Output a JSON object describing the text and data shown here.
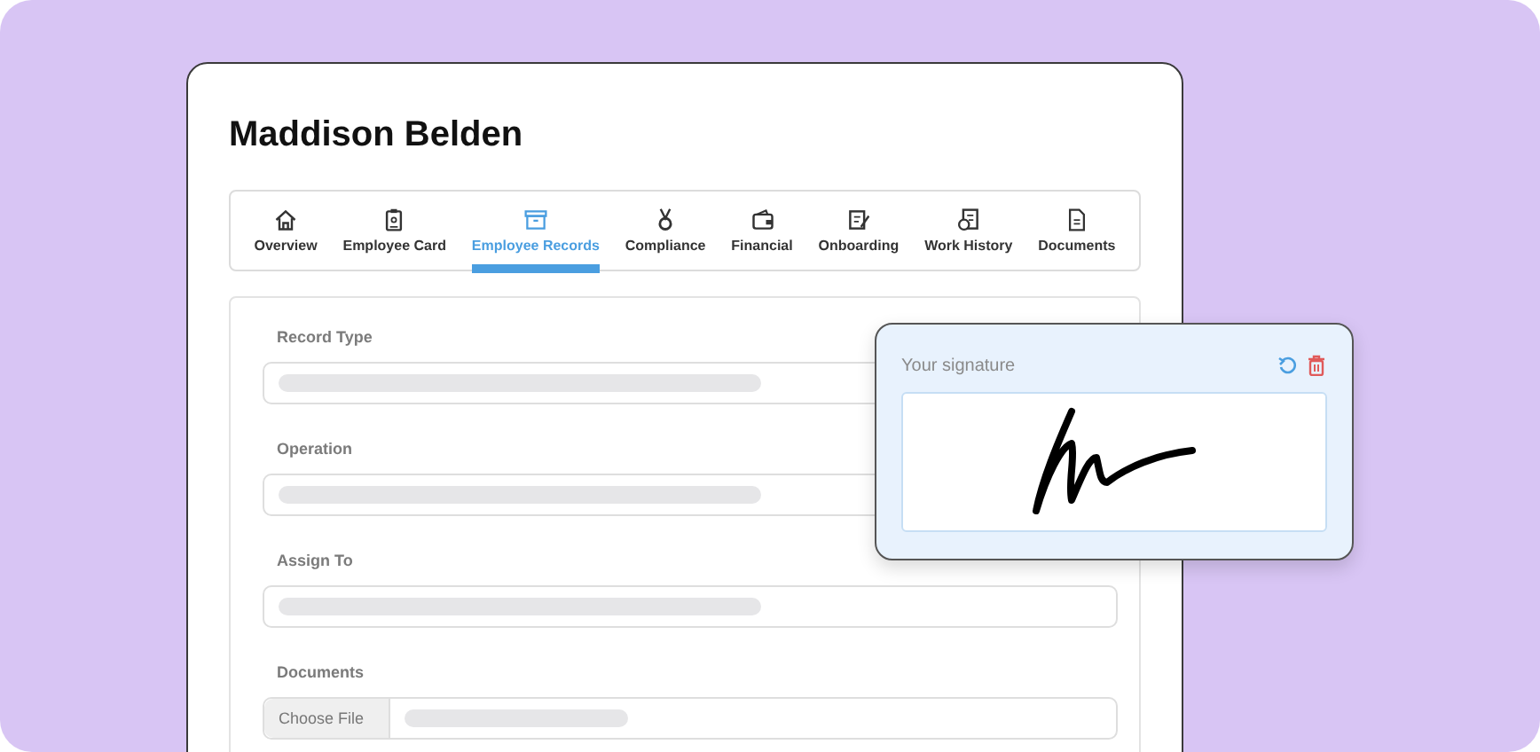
{
  "title": "Maddison Belden",
  "tabs": [
    {
      "label": "Overview",
      "selected": false
    },
    {
      "label": "Employee Card",
      "selected": false
    },
    {
      "label": "Employee Records",
      "selected": true
    },
    {
      "label": "Compliance",
      "selected": false
    },
    {
      "label": "Financial",
      "selected": false
    },
    {
      "label": "Onboarding",
      "selected": false
    },
    {
      "label": "Work History",
      "selected": false
    },
    {
      "label": "Documents",
      "selected": false
    }
  ],
  "fields": [
    {
      "label": "Record Type",
      "kind": "select"
    },
    {
      "label": "Operation",
      "kind": "select"
    },
    {
      "label": "Assign To",
      "kind": "select"
    },
    {
      "label": "Documents",
      "kind": "file",
      "button": "Choose File"
    }
  ],
  "signature": {
    "title": "Your signature"
  }
}
